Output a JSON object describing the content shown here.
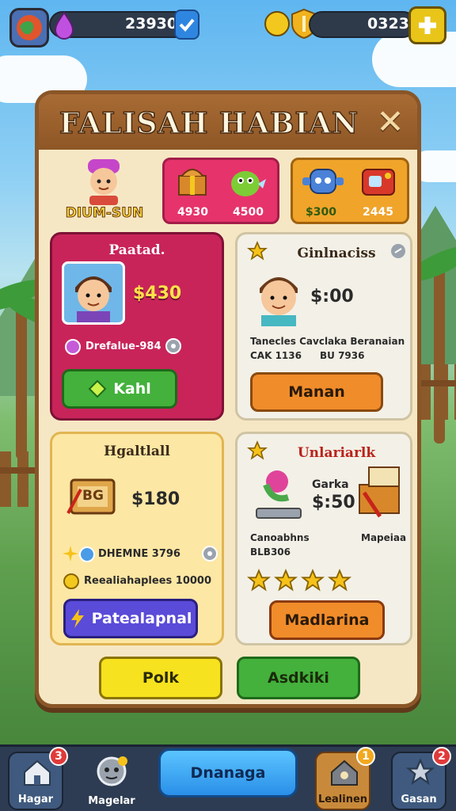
{
  "hud": {
    "gems_value": "23930",
    "coins_value": "0323"
  },
  "panel": {
    "title": "FALISAH HABIAN",
    "player_name": "DIUM-SUN",
    "bundle_pink": {
      "price_a": "4930",
      "price_b": "4500"
    },
    "bundle_orange": {
      "price_a": "$300",
      "price_b": "2445"
    }
  },
  "cards": {
    "red": {
      "title": "Paatad.",
      "price": "$430",
      "info": "Drefalue-984",
      "button": "Kahl"
    },
    "white_top": {
      "title": "Ginlnaciss",
      "price": "$:00",
      "desc_line1": "Tanecles Cavclaka Beranaian",
      "desc_line2": "CAK 1136",
      "desc_line3": "BU 7936",
      "button": "Manan"
    },
    "yellow": {
      "title": "Hgaltlall",
      "price": "$180",
      "crate_label": "BG",
      "info": "DHEMNE 3796",
      "reward": "Reealiahaplees 10000",
      "button": "Patealapnal"
    },
    "white_bottom": {
      "title": "Unlariarlk",
      "sub": "Garka",
      "price": "$:50",
      "desc_line1": "Canoabhns",
      "desc_line2": "BLB306",
      "side_label": "Mapeiaa",
      "button": "Madlarina"
    }
  },
  "footer": {
    "left_button": "Polk",
    "right_button": "Asdkiki"
  },
  "nav": {
    "items": [
      {
        "label": "Hagar",
        "badge": "3"
      },
      {
        "label": "Magelar",
        "badge": ""
      },
      {
        "label": "Dnanaga",
        "badge": ""
      },
      {
        "label": "Lealinen",
        "badge": "1"
      },
      {
        "label": "Gasan",
        "badge": "2"
      }
    ]
  },
  "colors": {
    "panel_bg": "#f6e7c4",
    "panel_border": "#8a5628",
    "red_card": "#c8245a",
    "yellow_card": "#fde7a4",
    "green_button": "#43b13c",
    "orange_button": "#f08c2a",
    "purple_button": "#5a4bd8",
    "yellow_button": "#f7e21f",
    "blue_button": "#2ea4f2"
  }
}
